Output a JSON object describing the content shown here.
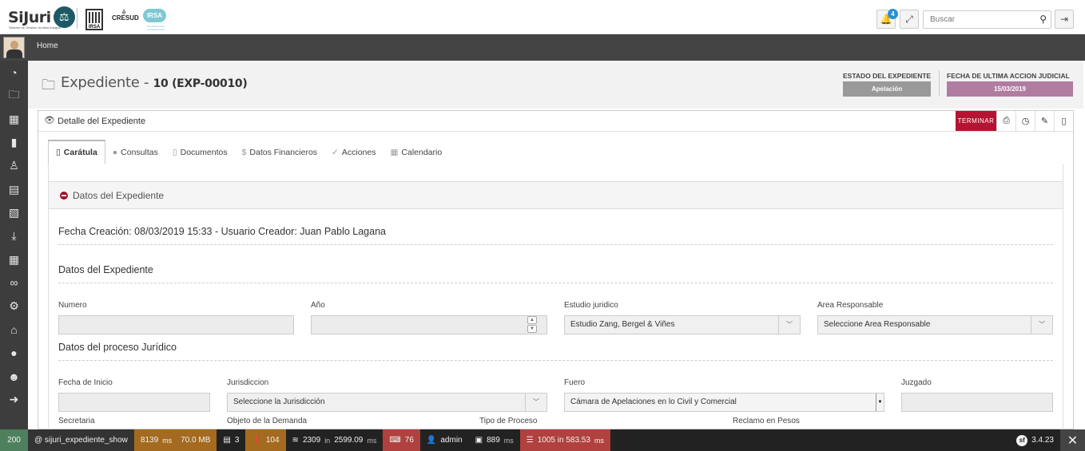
{
  "header": {
    "logo_text": "SiJuri",
    "logo_subtitle": "Sistema de Gestión Jurídica Integral",
    "brand_irsa": "IRSA",
    "brand_cresud": "CRESUD",
    "brand_irsa2": "IRSA",
    "brand_irsa2_sub": "PROPIEDADES COMERCIALES",
    "notifications_count": "4",
    "search_placeholder": "Buscar"
  },
  "breadcrumb": {
    "home": "Home"
  },
  "sidebar": {
    "items": [
      "dashboard-icon",
      "folder-icon",
      "building-icon",
      "bookmark-icon",
      "person-icon",
      "document-icon",
      "image-icon",
      "download-icon",
      "table-icon",
      "link-icon",
      "cogs-icon",
      "bank-icon",
      "user-icon",
      "users-icon",
      "arrow-right-icon"
    ]
  },
  "page": {
    "title_prefix": "Expediente - ",
    "title_id": "10 (EXP-00010)",
    "estado_label": "ESTADO DEL EXPEDIENTE",
    "estado_value": "Apelación",
    "fecha_label": "FECHA DE ULTIMA ACCION JUDICIAL",
    "fecha_value": "15/03/2019",
    "estado_color": "#999999",
    "fecha_color": "#b07ca0"
  },
  "panel": {
    "title": "Detalle del Expediente",
    "terminar": "TERMINAR",
    "tabs": [
      "Carátula",
      "Consultas",
      "Documentos",
      "Datos Financieros",
      "Acciones",
      "Calendario"
    ],
    "section_title": "Datos del Expediente",
    "creation_line": "Fecha Creación: 08/03/2019 15:33 - Usuario Creador: Juan Pablo Lagana",
    "sub1": "Datos del Expediente",
    "sub2": "Datos del proceso Jurídico"
  },
  "form": {
    "numero_label": "Numero",
    "anio_label": "Año",
    "estudio_label": "Estudio juridico",
    "estudio_value": "Estudio Zang, Bergel & Viñes",
    "area_label": "Area Responsable",
    "area_value": "Seleccione Area Responsable",
    "fecha_inicio_label": "Fecha de Inicio",
    "jurisdiccion_label": "Jurisdiccion",
    "jurisdiccion_value": "Seleccione la Jurisdicción",
    "fuero_label": "Fuero",
    "fuero_value": "Cámara de Apelaciones en lo Civil y Comercial",
    "juzgado_label": "Juzgado",
    "secretaria_label": "Secretaria",
    "objeto_label": "Objeto de la Demanda",
    "tipo_label": "Tipo de Proceso",
    "reclamo_label": "Reclamo en Pesos"
  },
  "debug": {
    "status": "200",
    "route": "@ sijuri_expediente_show",
    "time": "8139",
    "time_unit": "ms",
    "memory": "70.0 MB",
    "forms": "3",
    "logs": "104",
    "cache": "2309",
    "cache_in": "in",
    "cache_time": "2599.09",
    "cache_unit": "ms",
    "translations": "76",
    "user": "admin",
    "twig": "889",
    "twig_unit": "ms",
    "db": "1005 in 583.53",
    "db_unit": "ms",
    "version": "3.4.23"
  }
}
